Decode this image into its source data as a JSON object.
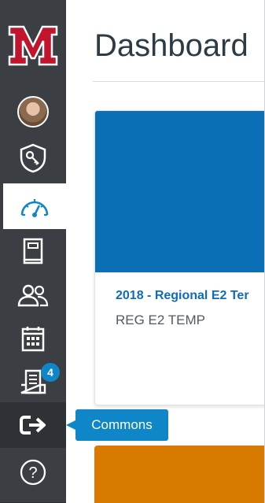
{
  "brand": {
    "logo_letter": "M",
    "logo_colors": {
      "red": "#c3142d",
      "white": "#ffffff"
    }
  },
  "sidebar": {
    "items": [
      {
        "name": "account",
        "icon": "avatar"
      },
      {
        "name": "admin",
        "icon": "shield-key-icon"
      },
      {
        "name": "dashboard",
        "icon": "speedometer-icon",
        "active": true
      },
      {
        "name": "courses",
        "icon": "book-icon"
      },
      {
        "name": "groups",
        "icon": "people-icon"
      },
      {
        "name": "calendar",
        "icon": "calendar-icon"
      },
      {
        "name": "inbox",
        "icon": "inbox-icon",
        "badge": "4"
      },
      {
        "name": "commons",
        "icon": "commons-arrow-icon"
      },
      {
        "name": "help",
        "icon": "help-icon"
      }
    ]
  },
  "tooltip": {
    "label": "Commons"
  },
  "header": {
    "title": "Dashboard"
  },
  "cards": [
    {
      "title": "2018 - Regional E2 Ter",
      "subtitle": "REG E2 TEMP",
      "color": "#0a6fb5"
    },
    {
      "title": "",
      "subtitle": "",
      "color": "#d97a00"
    }
  ],
  "colors": {
    "sidebar_bg": "#3b3f44",
    "accent": "#0f86c7",
    "text_dark": "#2d3b45"
  }
}
